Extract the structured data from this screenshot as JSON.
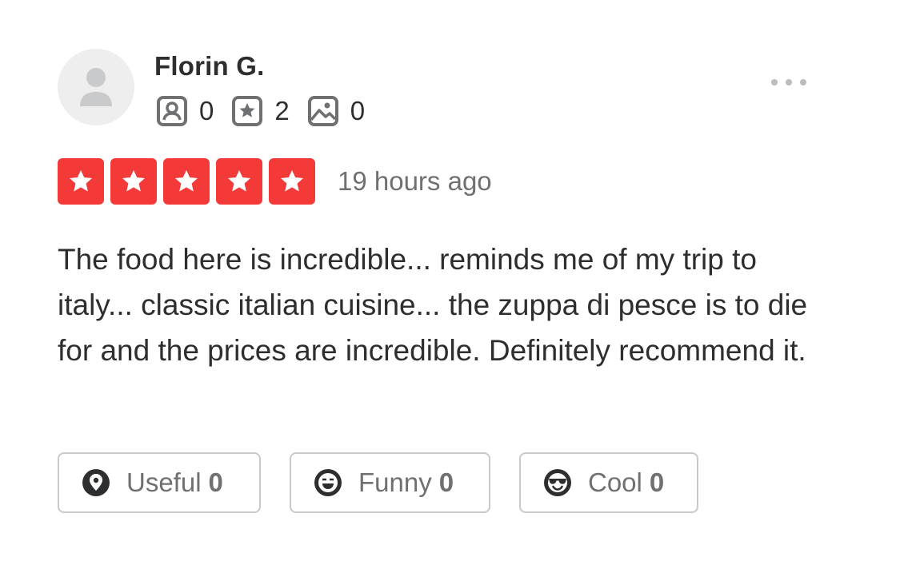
{
  "review": {
    "user": {
      "name": "Florin G.",
      "avatar_icon": "default-user-avatar-icon",
      "stats": {
        "friends": "0",
        "reviews": "2",
        "photos": "0"
      }
    },
    "menu_icon": "more-options-icon",
    "rating": 5,
    "rating_max": 5,
    "star_color": "#f43939",
    "date": "19 hours ago",
    "text": "The food here is incredible... reminds me of my trip to italy... classic italian cuisine... the zuppa di pesce is to die for and the prices are incredible. Definitely recommend it.",
    "reactions": {
      "useful": {
        "label": "Useful",
        "count": "0",
        "icon": "useful-icon"
      },
      "funny": {
        "label": "Funny",
        "count": "0",
        "icon": "funny-icon"
      },
      "cool": {
        "label": "Cool",
        "count": "0",
        "icon": "cool-icon"
      }
    }
  }
}
